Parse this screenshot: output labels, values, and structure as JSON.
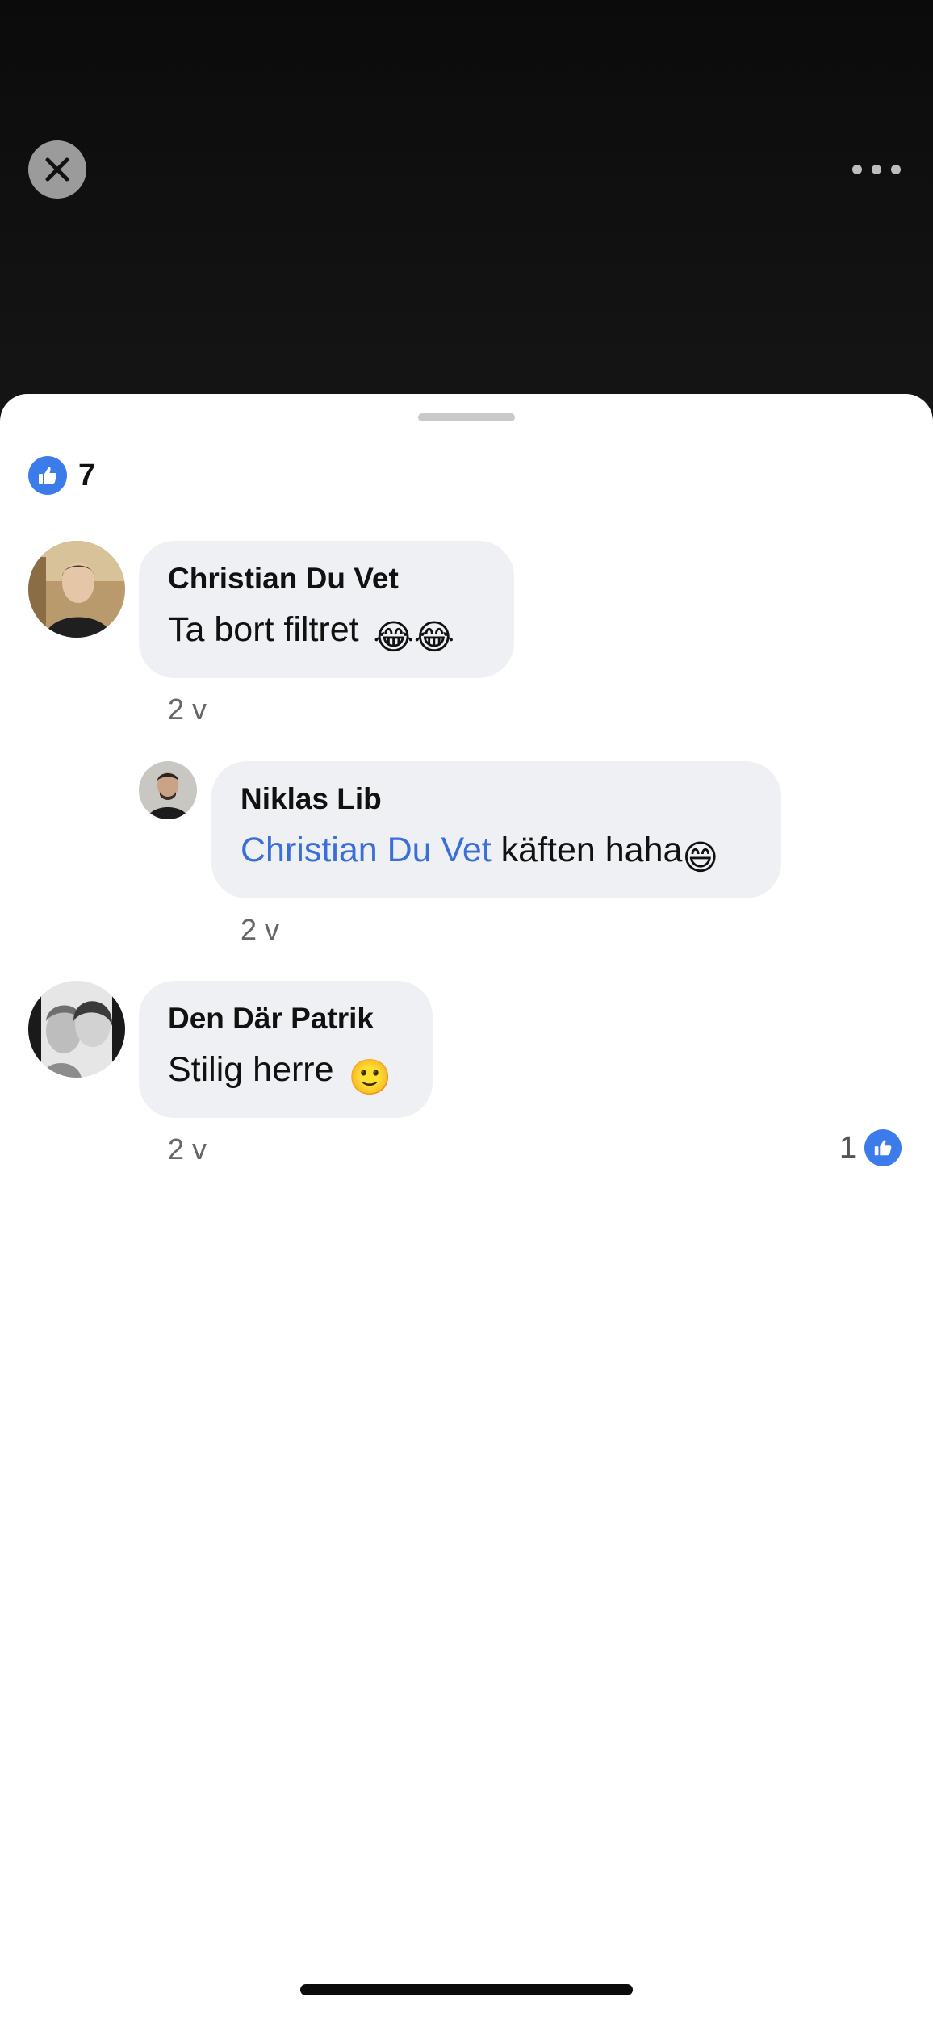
{
  "reactions": {
    "like_count": "7",
    "icon": "like-icon"
  },
  "comments": [
    {
      "author": "Christian Du Vet",
      "text": "Ta bort filtret",
      "emoji": "😂😂",
      "time": "2 v"
    },
    {
      "author": "Niklas Lib",
      "mention": "Christian Du Vet",
      "text": " käften haha",
      "emoji": "😄",
      "time": "2 v"
    },
    {
      "author": "Den Där Patrik",
      "text": "Stilig herre",
      "emoji": "🙂",
      "time": "2 v",
      "likes": "1"
    }
  ],
  "icons": {
    "close": "close-icon",
    "more": "more-icon",
    "like": "like-icon"
  },
  "colors": {
    "accent": "#3c7bea",
    "mention": "#3a6fd8",
    "bubble": "#eff0f3"
  }
}
